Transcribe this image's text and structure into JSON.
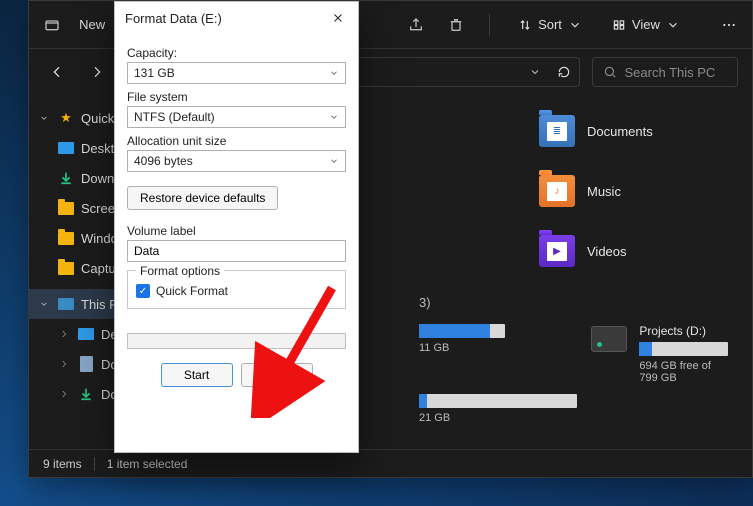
{
  "explorer": {
    "titlebar": {
      "new_label": "New",
      "sort_label": "Sort",
      "view_label": "View"
    },
    "search_placeholder": "Search This PC",
    "sidebar": {
      "quick_access": "Quick access",
      "desktop": "Desktop",
      "downloads": "Downloads",
      "screenshots": "Screenshots",
      "windows": "Windows",
      "captures": "Captures",
      "this_pc": "This PC",
      "pc_desktop": "Desktop",
      "pc_documents": "Documents",
      "pc_downloads": "Downloads"
    },
    "libraries": {
      "documents": "Documents",
      "music": "Music",
      "videos": "Videos"
    },
    "drives_header_count": "3)",
    "drives": {
      "c": {
        "free_text": "11 GB",
        "free_text2": "21 GB"
      },
      "d": {
        "name": "Projects (D:)",
        "free_text": "694 GB free of 799 GB",
        "fill_pct": 14
      }
    },
    "status": {
      "items": "9 items",
      "selected": "1 item selected"
    }
  },
  "dialog": {
    "title": "Format Data (E:)",
    "capacity_label": "Capacity:",
    "capacity_value": "131 GB",
    "filesystem_label": "File system",
    "filesystem_value": "NTFS (Default)",
    "alloc_label": "Allocation unit size",
    "alloc_value": "4096 bytes",
    "restore_label": "Restore device defaults",
    "volume_label_label": "Volume label",
    "volume_label_value": "Data",
    "format_options_label": "Format options",
    "quick_format_label": "Quick Format",
    "start_label": "Start",
    "close_label": "Close"
  }
}
